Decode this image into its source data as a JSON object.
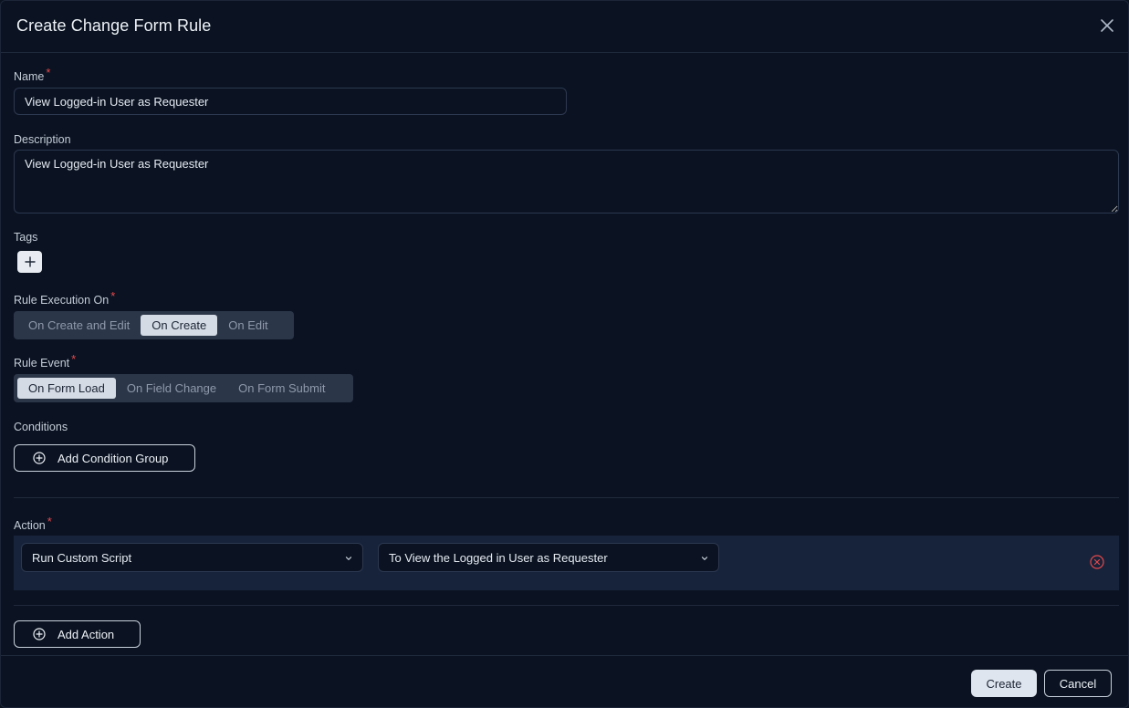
{
  "dialog": {
    "title": "Create Change Form Rule"
  },
  "form": {
    "name": {
      "label": "Name",
      "required_mark": "*",
      "value": "View Logged-in User as Requester"
    },
    "description": {
      "label": "Description",
      "value": "View Logged-in User as Requester"
    },
    "tags": {
      "label": "Tags",
      "add_icon": "plus-icon"
    },
    "rule_execution_on": {
      "label": "Rule Execution On",
      "required_mark": "*",
      "options": [
        "On Create and Edit",
        "On Create",
        "On Edit"
      ],
      "selected": "On Create"
    },
    "rule_event": {
      "label": "Rule Event",
      "required_mark": "*",
      "options": [
        "On Form Load",
        "On Field Change",
        "On Form Submit"
      ],
      "selected": "On Form Load"
    },
    "conditions": {
      "label": "Conditions",
      "add_button": "Add Condition Group"
    },
    "action": {
      "label": "Action",
      "required_mark": "*",
      "rows": [
        {
          "action_type": "Run Custom Script",
          "script": "To View the Logged in User as Requester"
        }
      ],
      "add_button": "Add Action"
    }
  },
  "footer": {
    "create_label": "Create",
    "cancel_label": "Cancel"
  },
  "colors": {
    "background": "#0b1322",
    "required": "#e5484d",
    "segment_active": "#d4dbe5",
    "action_row": "#17233a"
  }
}
